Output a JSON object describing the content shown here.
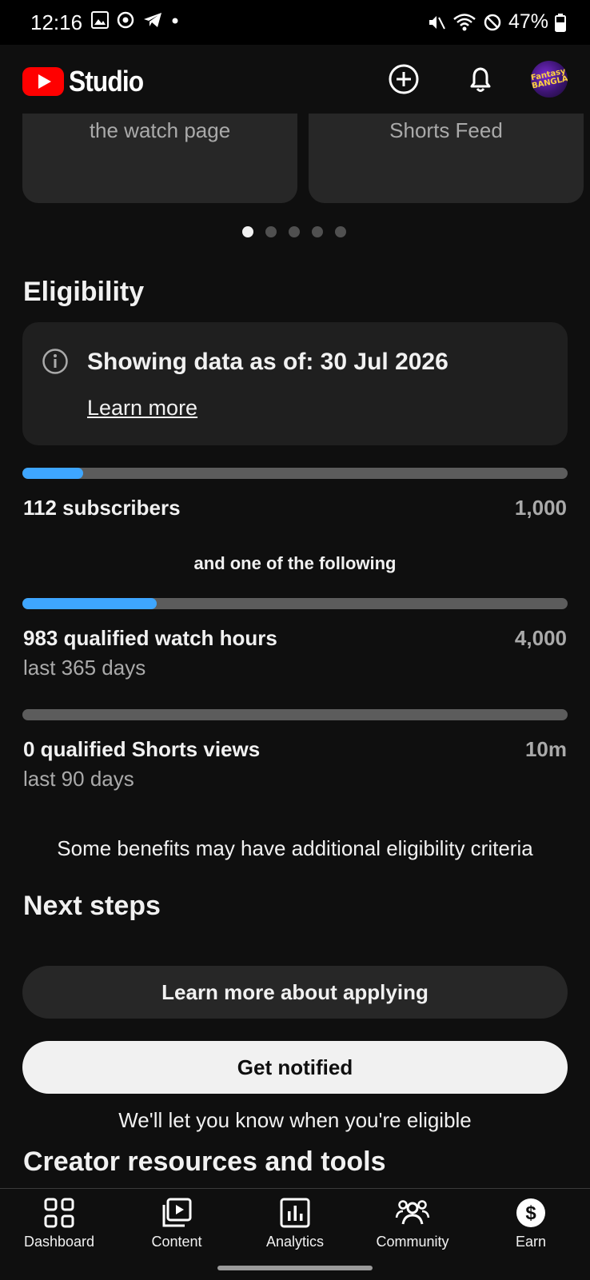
{
  "status_bar": {
    "time": "12:16",
    "battery": "47%"
  },
  "app": {
    "title": "Studio"
  },
  "cards": [
    {
      "text": "the watch page"
    },
    {
      "text": "Shorts Feed"
    }
  ],
  "carousel": {
    "total": 5,
    "active": 0
  },
  "eligibility": {
    "heading": "Eligibility",
    "info_title": "Showing data as of: 30 Jul 2026",
    "learn_more": "Learn more",
    "subscribers": {
      "label": "112 subscribers",
      "target": "1,000",
      "value": 112,
      "max": 1000
    },
    "separator": "and one of the following",
    "watch_hours": {
      "label": "983 qualified watch hours",
      "sub": "last 365 days",
      "target": "4,000",
      "value": 983,
      "max": 4000
    },
    "shorts_views": {
      "label": "0 qualified Shorts views",
      "sub": "last 90 days",
      "target": "10m",
      "value": 0,
      "max": 10000000
    },
    "note": "Some benefits may have additional eligibility criteria"
  },
  "next_steps": {
    "heading": "Next steps",
    "learn_button": "Learn more about applying",
    "notify_button": "Get notified",
    "notify_caption": "We'll let you know when you're eligible"
  },
  "resources": {
    "heading": "Creator resources and tools"
  },
  "avatar": {
    "text": "Fantasy BANGLA"
  },
  "bottom_nav": [
    {
      "label": "Dashboard",
      "icon": "dashboard-icon"
    },
    {
      "label": "Content",
      "icon": "content-icon"
    },
    {
      "label": "Analytics",
      "icon": "analytics-icon"
    },
    {
      "label": "Community",
      "icon": "community-icon"
    },
    {
      "label": "Earn",
      "icon": "earn-icon"
    }
  ],
  "colors": {
    "accent": "#3ea6ff",
    "brand_red": "#ff0000",
    "background": "#0f0f0f"
  }
}
